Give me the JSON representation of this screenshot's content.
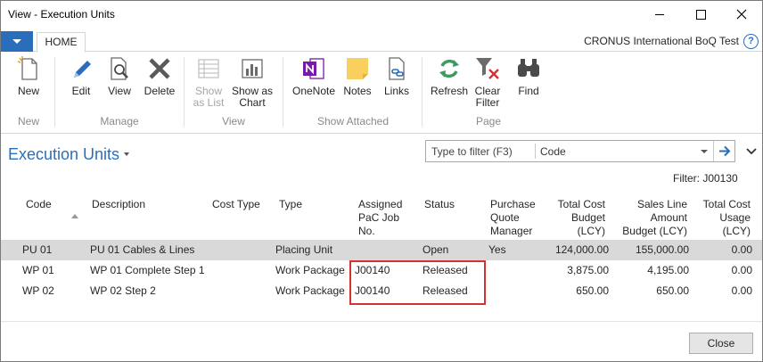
{
  "window": {
    "title": "View - Execution Units"
  },
  "ribbon_tabs": {
    "home": "HOME",
    "company": "CRONUS International BoQ Test"
  },
  "ribbon": {
    "new": "New",
    "edit": "Edit",
    "view": "View",
    "delete": "Delete",
    "show_as_list": [
      "Show",
      "as List"
    ],
    "show_as_chart": [
      "Show as",
      "Chart"
    ],
    "onenote": "OneNote",
    "notes": "Notes",
    "links": "Links",
    "refresh": "Refresh",
    "clear_filter": [
      "Clear",
      "Filter"
    ],
    "find": "Find",
    "groups": {
      "new": "New",
      "manage": "Manage",
      "view": "View",
      "show_attached": "Show Attached",
      "page": "Page"
    }
  },
  "page": {
    "title": "Execution Units",
    "filter_placeholder": "Type to filter (F3)",
    "filter_field": "Code",
    "filter_label": "Filter: J00130"
  },
  "columns": {
    "code": [
      "Code"
    ],
    "description": [
      "Description"
    ],
    "cost_type": [
      "Cost Type"
    ],
    "type": [
      "Type"
    ],
    "assigned": [
      "Assigned",
      "PaC Job",
      "No."
    ],
    "status": [
      "Status"
    ],
    "purchase": [
      "Purchase",
      "Quote",
      "Manager"
    ],
    "total_cost_budget": [
      "Total Cost",
      "Budget",
      "(LCY)"
    ],
    "sales_line": [
      "Sales Line",
      "Amount",
      "Budget (LCY)"
    ],
    "total_cost_usage": [
      "Total Cost",
      "Usage",
      "(LCY)"
    ]
  },
  "rows": [
    {
      "code": "PU 01",
      "description": "PU 01 Cables & Lines",
      "cost_type": "",
      "type": "Placing Unit",
      "job": "",
      "status": "Open",
      "purchase": "Yes",
      "total_cost_budget": "124,000.00",
      "sales_line": "155,000.00",
      "usage": "0.00"
    },
    {
      "code": "WP 01",
      "description": "WP 01 Complete Step 1",
      "cost_type": "",
      "type": "Work Package",
      "job": "J00140",
      "status": "Released",
      "purchase": "",
      "total_cost_budget": "3,875.00",
      "sales_line": "4,195.00",
      "usage": "0.00"
    },
    {
      "code": "WP 02",
      "description": "WP 02 Step 2",
      "cost_type": "",
      "type": "Work Package",
      "job": "J00140",
      "status": "Released",
      "purchase": "",
      "total_cost_budget": "650.00",
      "sales_line": "650.00",
      "usage": "0.00"
    }
  ],
  "footer": {
    "close": "Close"
  },
  "colors": {
    "accent": "#2a6ebb",
    "highlight": "#d43232",
    "selected_row": "#d9d9d9"
  }
}
